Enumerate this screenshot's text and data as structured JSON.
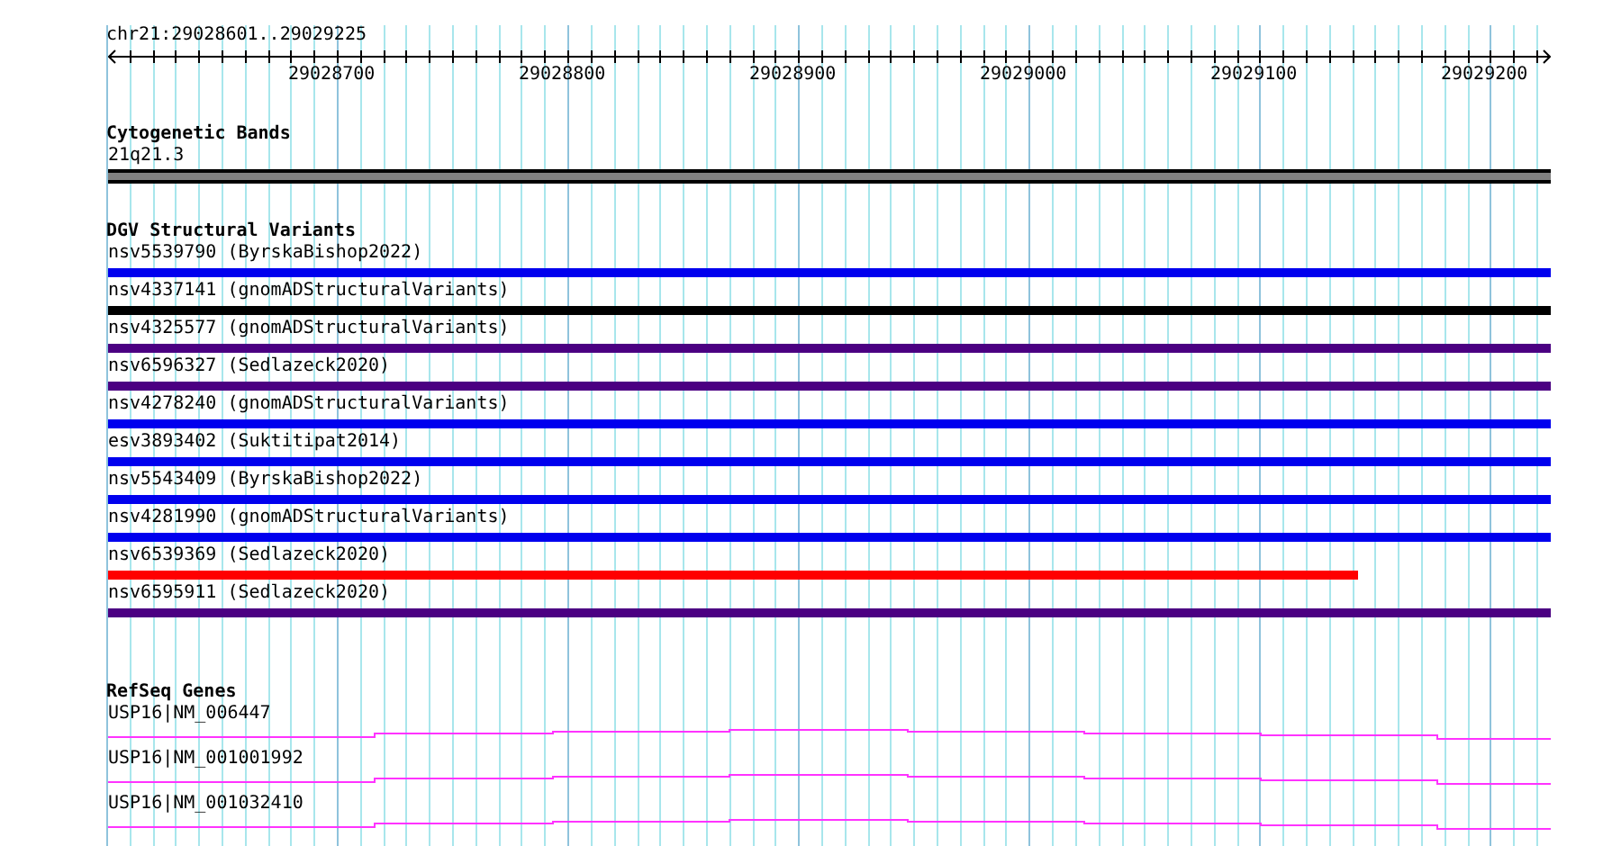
{
  "location": "chr21:29028601..29029225",
  "ruler": {
    "ticks": [
      "29028700",
      "29028800",
      "29028900",
      "29029000",
      "29029100",
      "29029200"
    ]
  },
  "tracks": [
    {
      "kind": "bands",
      "title": "Cytogenetic Bands",
      "features": [
        {
          "label": "21q21.3"
        }
      ]
    },
    {
      "kind": "variants",
      "title": "DGV Structural Variants",
      "features": [
        {
          "label": "nsv5539790 (ByrskaBishop2022)",
          "color": "#0000ee",
          "continues_right": true
        },
        {
          "label": "nsv4337141 (gnomADStructuralVariants)",
          "color": "#000000",
          "continues_right": true
        },
        {
          "label": "nsv4325577 (gnomADStructuralVariants)",
          "color": "#4b0082",
          "continues_right": true
        },
        {
          "label": "nsv6596327 (Sedlazeck2020)",
          "color": "#4b0082",
          "continues_right": true
        },
        {
          "label": "nsv4278240 (gnomADStructuralVariants)",
          "color": "#0000ee",
          "continues_right": true
        },
        {
          "label": "esv3893402 (Suktitipat2014)",
          "color": "#0000ee",
          "continues_right": true
        },
        {
          "label": "nsv5543409 (ByrskaBishop2022)",
          "color": "#0000ee",
          "continues_right": true
        },
        {
          "label": "nsv4281990 (gnomADStructuralVariants)",
          "color": "#0000ee",
          "continues_right": true
        },
        {
          "label": "nsv6539369 (Sedlazeck2020)",
          "color": "#ff0000",
          "continues_right": false
        },
        {
          "label": "nsv6595911 (Sedlazeck2020)",
          "color": "#4b0082",
          "continues_right": true
        }
      ]
    },
    {
      "kind": "genes",
      "title": "RefSeq Genes",
      "features": [
        {
          "label": "USP16|NM_006447"
        },
        {
          "label": "USP16|NM_001001992"
        },
        {
          "label": "USP16|NM_001032410"
        }
      ]
    }
  ]
}
